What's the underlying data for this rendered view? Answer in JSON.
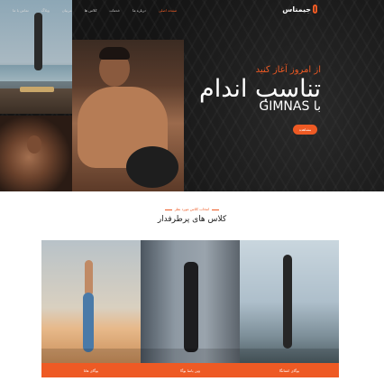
{
  "nav": {
    "logo_text": "جیمناس",
    "items": [
      "صفحه اصلی",
      "درباره ما",
      "خدمات",
      "کلاس ها",
      "مربیان",
      "وبلاگ",
      "تماس با ما"
    ]
  },
  "hero": {
    "kicker": "از امروز آغاز کنید",
    "title": "تناسب اندام",
    "subtitle": "GIMNAS با",
    "button": "مشاهده"
  },
  "section": {
    "kicker": "انتخاب کلاس مورد نظر",
    "title": "کلاس های پرطرفدار"
  },
  "classes": [
    {
      "label": "یوگای هاتا"
    },
    {
      "label": "وین یاسا یوگا"
    },
    {
      "label": "یوگای اشتانگا"
    }
  ],
  "colors": {
    "accent": "#ee5a24",
    "hero_bg": "#141414"
  }
}
